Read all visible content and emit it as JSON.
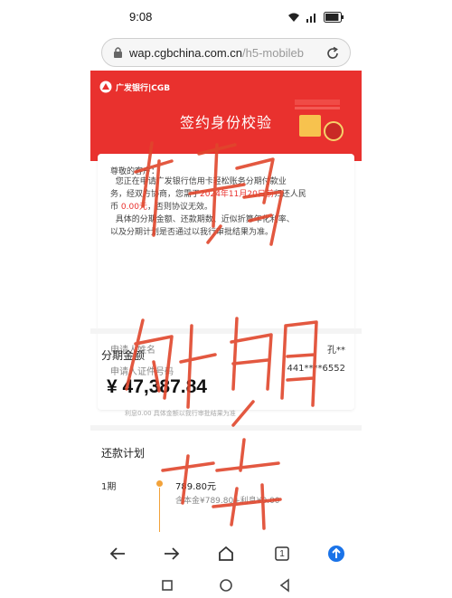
{
  "status_bar": {
    "time": "9:08",
    "battery_level": 0.9
  },
  "url_bar": {
    "host": "wap.cgbchina.com.cn",
    "path": "/h5-mobileb"
  },
  "header": {
    "brand": "广发银行|CGB",
    "title": "签约身份校验"
  },
  "notice": {
    "greeting": "尊敬的客户：",
    "line1": "您正在申请广发银行信用卡轻松账务分期付款业",
    "line2": "务，经双方协商，您需于",
    "deadline": "2024年11月20日前",
    "line3": "归还人民",
    "line4_prefix": "币",
    "fee": "0.00元",
    "line4_suffix": "，否则协议无效。",
    "line5": "具体的分期金额、还款期数、近似折算年化利率、",
    "line6": "以及分期计划是否通过以我行审批结果为准。"
  },
  "applicant": {
    "name_label": "申请人姓名",
    "name_value": "孔**",
    "id_label": "申请人证件号码",
    "id_value": "441****6552"
  },
  "installment": {
    "title": "分期金额",
    "amount": "¥ 47,387.84",
    "note": "利息0.00 具体金额以我行审批结果为准"
  },
  "plan": {
    "title": "还款计划",
    "period": "1期",
    "amount": "789.80元",
    "detail": "含本金¥789.80+利息¥0.00"
  },
  "toolbar": {
    "tab_count": "1"
  },
  "colors": {
    "brand_red": "#e9312e",
    "accent_blue": "#1a73e8",
    "ink_red": "#e0462c"
  },
  "icons": [
    "wifi-icon",
    "signal-icon",
    "battery-icon",
    "lock-icon",
    "reload-icon",
    "back-icon",
    "forward-icon",
    "home-icon",
    "tabs-icon",
    "menu-upload-icon",
    "nav-square-icon",
    "nav-circle-icon",
    "nav-back-icon"
  ]
}
